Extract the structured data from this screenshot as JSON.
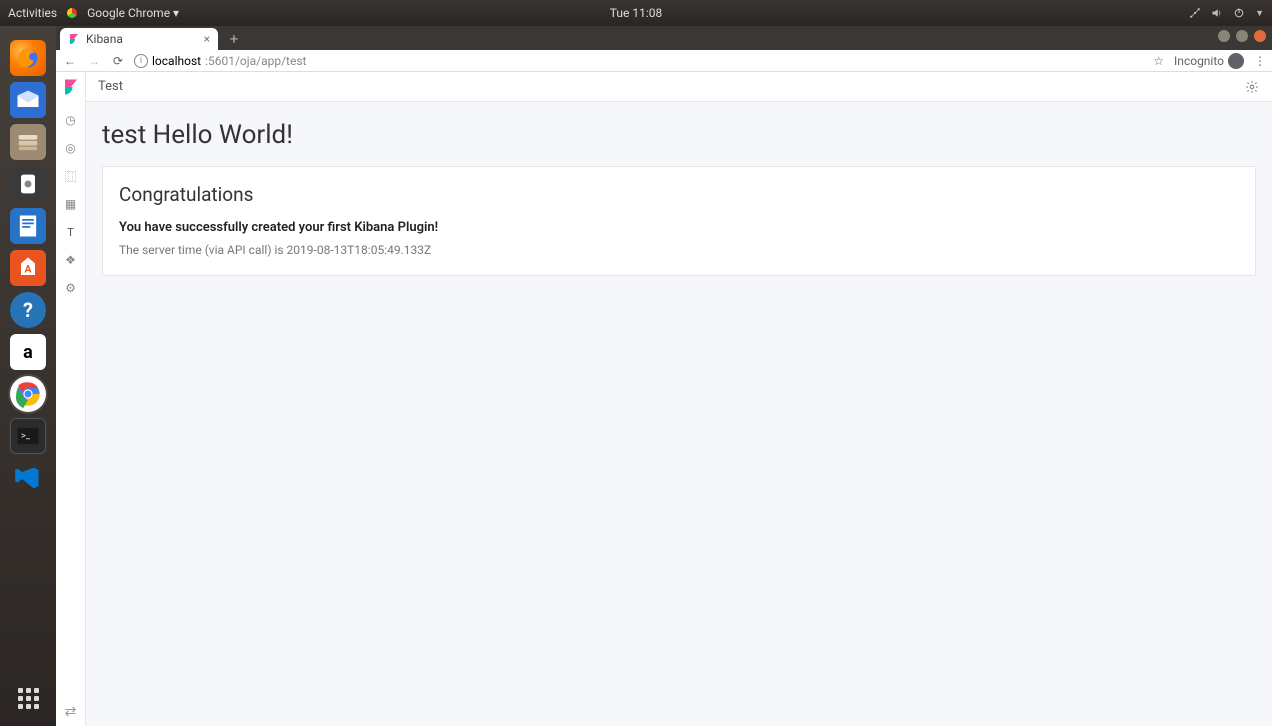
{
  "gnome": {
    "activities": "Activities",
    "app_menu": "Google Chrome ▾",
    "clock": "Tue 11:08"
  },
  "browser": {
    "tab_title": "Kibana",
    "url_host": "localhost",
    "url_path": ":5601/oja/app/test",
    "incognito_label": "Incognito"
  },
  "kibana": {
    "breadcrumb": "Test",
    "nav_items": [
      {
        "name": "recent",
        "glyph": "◷"
      },
      {
        "name": "discover",
        "glyph": "◎"
      },
      {
        "name": "visualize",
        "glyph": "⿲"
      },
      {
        "name": "dashboard",
        "glyph": "▦"
      },
      {
        "name": "test-plugin",
        "glyph": "T"
      },
      {
        "name": "dev-tools",
        "glyph": "❖"
      },
      {
        "name": "management",
        "glyph": "⚙"
      }
    ],
    "page_title": "test Hello World!",
    "panel_title": "Congratulations",
    "panel_bold": "You have successfully created your first Kibana Plugin!",
    "panel_sub": "The server time (via API call) is 2019-08-13T18:05:49.133Z"
  }
}
